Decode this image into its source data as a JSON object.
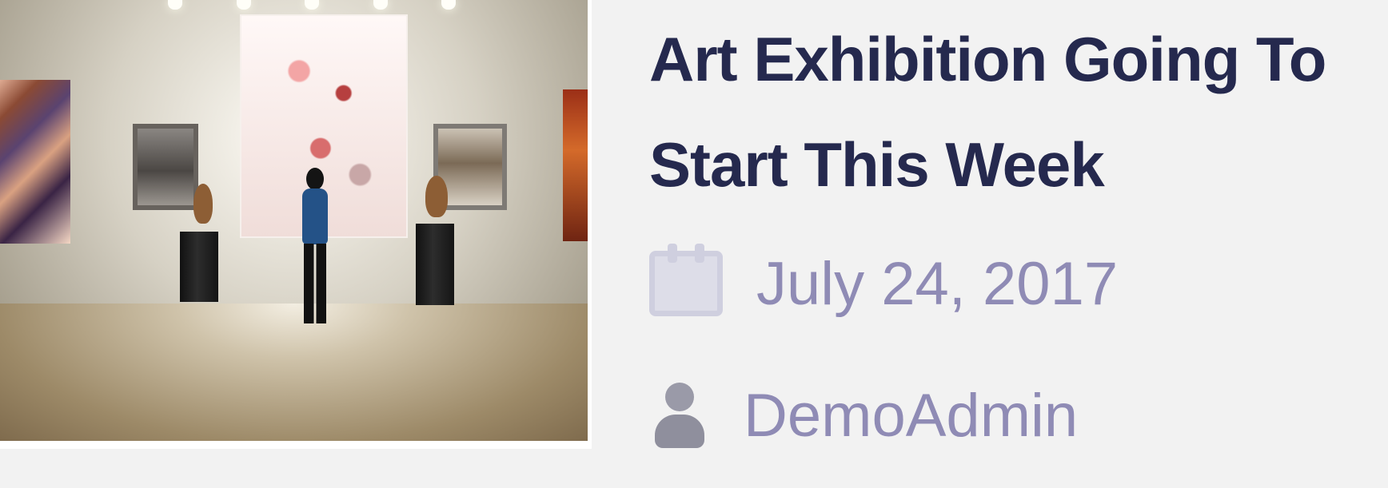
{
  "post": {
    "title": "Art Exhibition Going To Start This Week",
    "date": "July 24, 2017",
    "author": "DemoAdmin",
    "thumbnail_icon": "art-gallery-image",
    "date_icon": "calendar-icon",
    "author_icon": "user-icon"
  }
}
